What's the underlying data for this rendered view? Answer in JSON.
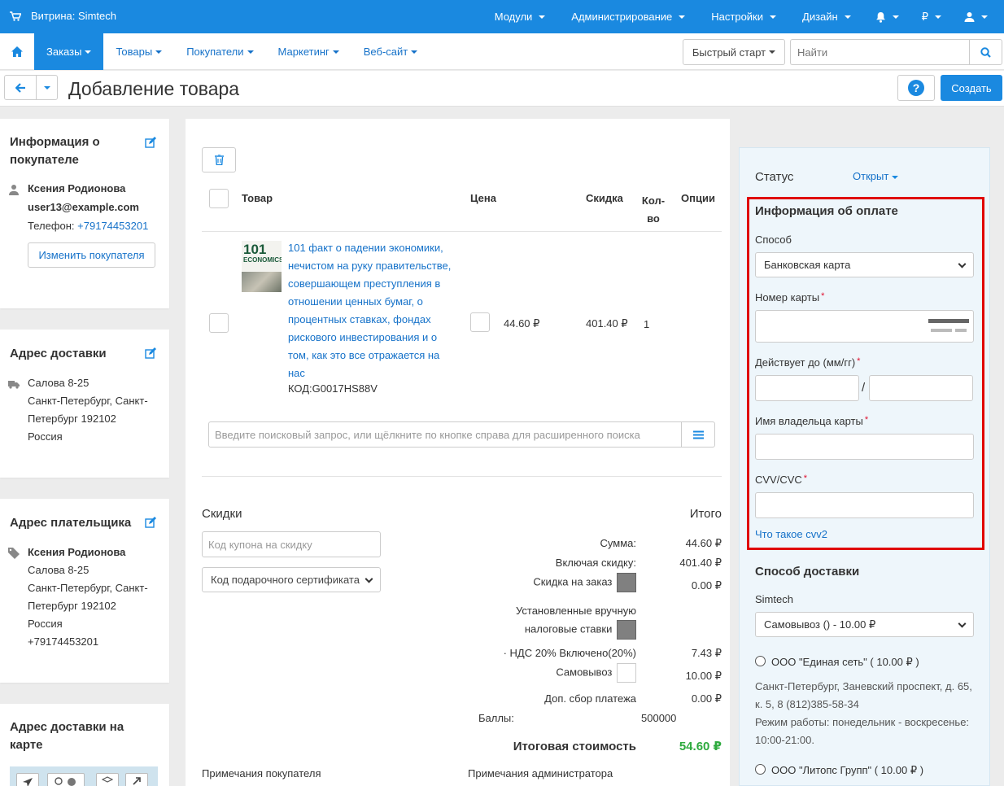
{
  "topbar": {
    "store_label": "Витрина: Simtech",
    "menu": [
      "Модули",
      "Администрирование",
      "Настройки",
      "Дизайн"
    ],
    "currency": "₽"
  },
  "nav": {
    "tabs": [
      "Заказы",
      "Товары",
      "Покупатели",
      "Маркетинг",
      "Веб-сайт"
    ],
    "quick_start": "Быстрый старт",
    "search_placeholder": "Найти"
  },
  "titlebar": {
    "title": "Добавление товара",
    "help": "?",
    "create": "Создать"
  },
  "customer": {
    "title": "Информация о покупателе",
    "name": "Ксения Родионова",
    "email": "user13@example.com",
    "phone_label": "Телефон:",
    "phone": "+79174453201",
    "change_button": "Изменить покупателя"
  },
  "shipping_address": {
    "title": "Адрес доставки",
    "line1": "Салова 8-25",
    "line2": "Санкт-Петербург, Санкт-",
    "line3": "Петербург 192102",
    "line4": "Россия"
  },
  "billing_address": {
    "title": "Адрес плательщика",
    "name": "Ксения Родионова",
    "line1": "Салова 8-25",
    "line2": "Санкт-Петербург, Санкт-",
    "line3": "Петербург 192102",
    "line4": "Россия",
    "phone": "+79174453201"
  },
  "map": {
    "title_line1": "Адрес доставки на",
    "title_line2": "карте"
  },
  "products": {
    "headers": {
      "product": "Товар",
      "price": "Цена",
      "discount": "Скидка",
      "qty_1": "Кол-",
      "qty_2": "во",
      "options": "Опции"
    },
    "item": {
      "thumb_line1": "101",
      "thumb_line2": "ECONOMICS",
      "name_lines": [
        "101 факт о падении экономики,",
        "нечистом на руку правительстве,",
        "совершающем преступления в",
        "отношении ценных бумаг, о",
        "процентных ставках, фондах",
        "рискового инвестирования и о",
        "том, как это все отражается на",
        "нас"
      ],
      "code": "КОД:G0017HS88V",
      "price": "44.60 ₽",
      "discount": "401.40 ₽",
      "qty": "1"
    },
    "search_placeholder": "Введите поисковый запрос, или щёлкните по кнопке справа для расширенного поиска"
  },
  "discounts": {
    "title": "Скидки",
    "coupon_placeholder": "Код купона на скидку",
    "gift_placeholder": "Код подарочного сертификата"
  },
  "totals": {
    "title": "Итого",
    "subtotal_label": "Сумма:",
    "subtotal": "44.60 ₽",
    "incl_discount_label": "Включая скидку:",
    "incl_discount": "401.40 ₽",
    "order_discount_label": "Скидка на заказ",
    "order_discount": "0.00 ₽",
    "manual_tax_label_1": "Установленные вручную",
    "manual_tax_label_2": "налоговые ставки",
    "vat_label": "· НДС 20% Включено(20%)",
    "vat": "7.43 ₽",
    "pickup_label": "Самовывоз",
    "pickup": "10.00 ₽",
    "surcharge_label": "Доп. сбор платежа",
    "surcharge": "0.00 ₽",
    "points_label": "Баллы:",
    "points": "500000",
    "grand_label": "Итоговая стоимость",
    "grand": "54.60 ₽",
    "grand_color": "#2eaa3e"
  },
  "notes": {
    "customer": "Примечания покупателя",
    "admin": "Примечания администратора"
  },
  "status": {
    "label": "Статус",
    "value": "Открыт"
  },
  "payment": {
    "title": "Информация об оплате",
    "method_label": "Способ",
    "method_value": "Банковская карта",
    "card_number_label": "Номер карты",
    "expiry_label": "Действует до (мм/гг)",
    "expiry_sep": "/",
    "holder_label": "Имя владельца карты",
    "cvv_label": "CVV/CVC",
    "cvv_help": "Что такое cvv2",
    "required_mark": "*"
  },
  "shipping": {
    "title": "Способ доставки",
    "company": "Simtech",
    "selected": "Самовывоз () - 10.00 ₽",
    "options": [
      {
        "name": "ООО \"Единая сеть\" ( 10.00 ₽ )",
        "address_1": "Санкт-Петербург, Заневский проспект, д. 65,",
        "address_2": "к. 5, 8 (812)385-58-34",
        "hours_1": "Режим работы: понедельник - воскресенье:",
        "hours_2": "10:00-21:00."
      },
      {
        "name": "ООО \"Литопс Групп\" ( 10.00 ₽ )"
      }
    ]
  }
}
